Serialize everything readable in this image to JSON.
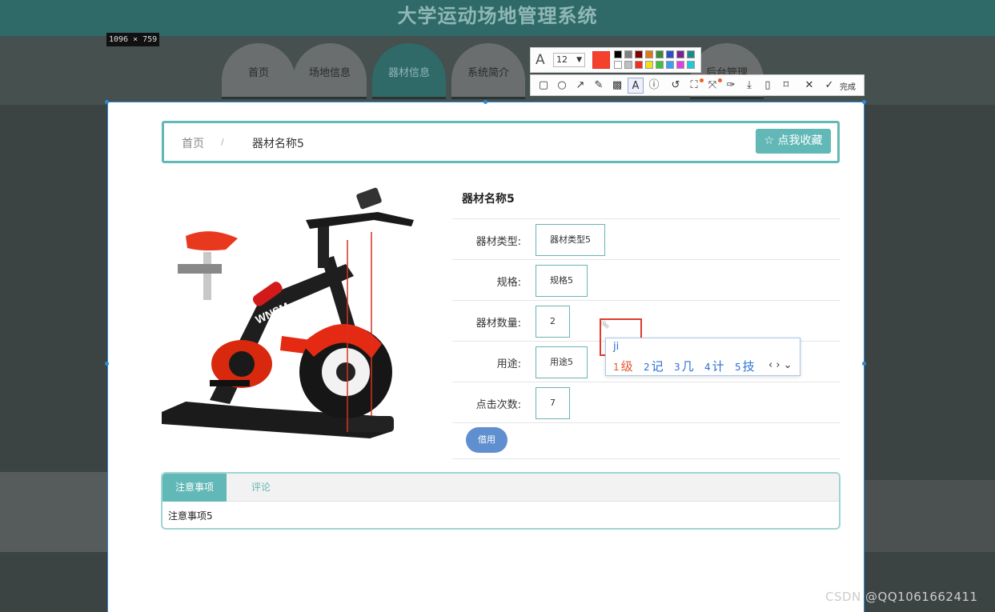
{
  "site": {
    "title": "大学运动场地管理系统",
    "nav": [
      {
        "label": "首页"
      },
      {
        "label": "场地信息"
      },
      {
        "label": "器材信息",
        "active": true
      },
      {
        "label": "系统简介"
      },
      {
        "label": "后台管理"
      }
    ]
  },
  "capture": {
    "size_label": "1096 × 759",
    "font_size": "12",
    "current_color": "#f5402c",
    "palette_row1": [
      "#000000",
      "#808080",
      "#800000",
      "#e07818",
      "#3a8a3a",
      "#2a50c8",
      "#7a2090",
      "#1a8a8a"
    ],
    "palette_row2": [
      "#ffffff",
      "#c0c0c0",
      "#f03020",
      "#f0e020",
      "#40c040",
      "#3aa0f0",
      "#e040e0",
      "#20c8d8"
    ],
    "tools": [
      "rectangle-icon",
      "ellipse-icon",
      "arrow-icon",
      "pencil-icon",
      "mosaic-icon",
      "text-icon",
      "number-icon",
      "undo-icon",
      "ocr-icon",
      "translate-icon",
      "pin-icon",
      "download-icon",
      "save-icon",
      "bookmark-icon",
      "close-icon",
      "check-icon"
    ],
    "done_label": "完成"
  },
  "breadcrumb": {
    "home": "首页",
    "separator": "/",
    "current": "器材名称5",
    "favorite_button": "☆ 点我收藏"
  },
  "equipment": {
    "name": "器材名称5",
    "fields": [
      {
        "label": "器材类型:",
        "value": "器材类型5"
      },
      {
        "label": "规格:",
        "value": "规格5"
      },
      {
        "label": "器材数量:",
        "value": "2"
      },
      {
        "label": "用途:",
        "value": "用途5"
      },
      {
        "label": "点击次数:",
        "value": "7"
      }
    ],
    "borrow_button": "借用"
  },
  "tabs": {
    "notes_tab": "注意事项",
    "comments_tab": "评论",
    "notes_content": "注意事项5"
  },
  "ime": {
    "input": "ji",
    "candidates": [
      {
        "num": "1",
        "text": "级"
      },
      {
        "num": "2",
        "text": "记"
      },
      {
        "num": "3",
        "text": "几"
      },
      {
        "num": "4",
        "text": "计"
      },
      {
        "num": "5",
        "text": "技"
      }
    ],
    "nav": "‹ › ⌄"
  },
  "watermark": "CSDN @QQ1061662411"
}
